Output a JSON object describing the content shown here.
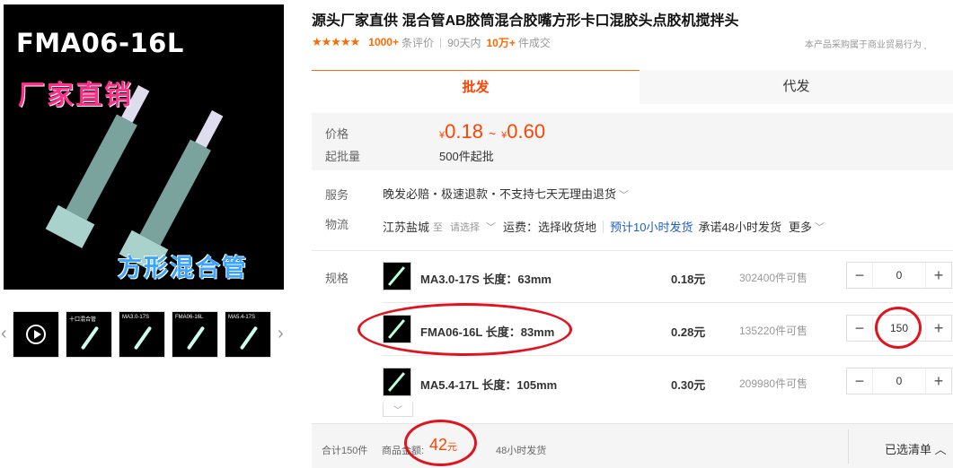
{
  "gallery": {
    "main_code": "FMA06-16L",
    "main_slogan": "厂家直销",
    "main_caption": "方形混合管",
    "thumbs": [
      {
        "type": "video",
        "text": ""
      },
      {
        "type": "image",
        "text": "十口混合管"
      },
      {
        "type": "image",
        "text": "MA3.0-17S"
      },
      {
        "type": "image",
        "text": "FMA06-16L"
      },
      {
        "type": "image",
        "text": "MA5.4-17S"
      }
    ]
  },
  "product": {
    "title": "源头厂家直供 混合管AB胶筒混合胶嘴方形卡口混胶头点胶机搅拌头",
    "stars": "★★★★★",
    "reviews_num": "1000+",
    "reviews_label": "条评价",
    "period": "90天内",
    "deals_num": "10万+",
    "deals_label": "件成交",
    "notice": "本产品采购属于商业贸易行为"
  },
  "tabs": [
    {
      "label": "批发",
      "active": true
    },
    {
      "label": "代发",
      "active": false
    }
  ],
  "pricing": {
    "price_label": "价格",
    "currency": "¥",
    "price_min": "0.18",
    "price_max": "0.60",
    "tilde": "~",
    "min_batch_label": "起批量",
    "min_batch": "500件起批"
  },
  "service": {
    "label": "服务",
    "text": "晚发必赔・极速退款・不支持七天无理由退货"
  },
  "logistics": {
    "label": "物流",
    "origin": "江苏盐城",
    "to": "至",
    "dest_placeholder": "请选择",
    "fee": "运费：选择收货地",
    "ship_time": "预计10小时发货",
    "promise": "承诺48小时发货",
    "more": "更多"
  },
  "spec": {
    "label": "规格",
    "rows": [
      {
        "name": "MA3.0-17S 长度：63mm",
        "price": "0.18元",
        "stock": "302400件可售",
        "qty": "0"
      },
      {
        "name": "FMA06-16L 长度：83mm",
        "price": "0.28元",
        "stock": "135220件可售",
        "qty": "150"
      },
      {
        "name": "MA5.4-17L 长度：105mm",
        "price": "0.30元",
        "stock": "209980件可售",
        "qty": "0"
      }
    ]
  },
  "footer": {
    "total": "合计150件",
    "amount_label": "商品金额:",
    "amount": "42",
    "amount_unit": "元",
    "ship": "48小时发货",
    "cart": "已选清单"
  },
  "colors": {
    "accent": "#ff4400",
    "link_blue": "#1c5dc9",
    "annotation_red": "#e0141e"
  }
}
